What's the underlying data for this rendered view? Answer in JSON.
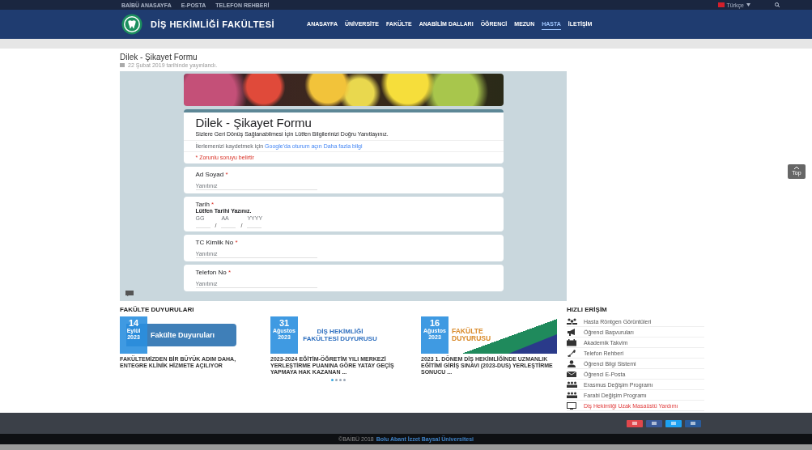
{
  "top_links": [
    "BAİBÜ ANASAYFA",
    "E-POSTA",
    "TELEFON REHBERİ"
  ],
  "language": {
    "label": "Türkçe"
  },
  "site_title": "DİŞ HEKİMLİĞİ FAKÜLTESİ",
  "nav": [
    {
      "label": "ANASAYFA",
      "selected": false
    },
    {
      "label": "ÜNİVERSİTE",
      "selected": false
    },
    {
      "label": "FAKÜLTE",
      "selected": false
    },
    {
      "label": "ANABİLİM DALLARI",
      "selected": false
    },
    {
      "label": "ÖĞRENCİ",
      "selected": false
    },
    {
      "label": "MEZUN",
      "selected": false
    },
    {
      "label": "HASTA",
      "selected": true
    },
    {
      "label": "İLETİŞİM",
      "selected": false
    }
  ],
  "page": {
    "title": "Dilek - Şikayet Formu",
    "meta": "22 Şubat 2019 tarihinde yayınlandı."
  },
  "form": {
    "title": "Dilek - Şikayet Formu",
    "description": "Sizlere Geri Dönüş Sağlanabilmesi İçin Lütfen  Bilgilerinizi Doğru Yanıtlayınız.",
    "signin_text": "İlerlemenizi kaydetmek için",
    "signin_link": "Google'da oturum açın",
    "more_link": "Daha fazla bilgi",
    "required_note": "* Zorunlu soruyu belirtir",
    "questions": [
      {
        "kind": "text",
        "label": "Ad Soyad",
        "required": true,
        "required_mark": "*",
        "placeholder": "Yanıtınız"
      },
      {
        "kind": "date",
        "label": "Tarih",
        "required": true,
        "required_mark": "*",
        "hint": "Lütfen Tarihi Yazınız.",
        "parts": [
          "GG",
          "AA",
          "YYYY"
        ],
        "separators": [
          "/",
          "/"
        ]
      },
      {
        "kind": "text",
        "label": "TC Kimlik No",
        "required": true,
        "required_mark": "*",
        "placeholder": "Yanıtınız"
      },
      {
        "kind": "text",
        "label": "Telefon No",
        "required": true,
        "required_mark": "*",
        "placeholder": "Yanıtınız"
      }
    ]
  },
  "top_button": {
    "label": "Top"
  },
  "announcements": {
    "title": "FAKÜLTE DUYURULARI",
    "items": [
      {
        "day": "14",
        "month": "Eylül",
        "year": "2023",
        "image_text": "Fakülte Duyuruları",
        "kind": "tab",
        "text": "FAKÜLTEMİZDEN BİR BÜYÜK ADIM DAHA, ENTEGRE KLİNİK HİZMETE AÇILIYOR"
      },
      {
        "day": "31",
        "month": "Ağustos",
        "year": "2023",
        "image_text": "DİŞ HEKİMLİĞİ FAKÜLTESİ DUYURUSU",
        "kind": "seal",
        "text": "2023-2024 EĞİTİM-ÖĞRETİM YILI MERKEZİ YERLEŞTİRME PUANINA GÖRE YATAY GEÇİŞ YAPMAYA HAK KAZANAN ..."
      },
      {
        "day": "16",
        "month": "Ağustos",
        "year": "2023",
        "image_text": "FAKÜLTE DUYURUSU",
        "kind": "flag",
        "text": "2023 1. DÖNEM DİŞ HEKİMLİĞİNDE UZMANLIK EĞİTİMİ GİRİŞ SINAVI (2023-DUS) YERLEŞTİRME SONUCU ..."
      }
    ],
    "dots": [
      {
        "selected": true
      },
      {
        "selected": false
      },
      {
        "selected": false
      },
      {
        "selected": false
      }
    ]
  },
  "quick_access": {
    "title": "HIZLI ERİŞİM",
    "items": [
      {
        "label": "Hasta Röntgen Görüntüleri",
        "kind": "people",
        "highlight": false
      },
      {
        "label": "Öğrenci Başvuruları",
        "kind": "megaphone",
        "highlight": false
      },
      {
        "label": "Akademik Takvim",
        "kind": "calendar",
        "highlight": false
      },
      {
        "label": "Telefon Rehberi",
        "kind": "phone",
        "highlight": false
      },
      {
        "label": "Öğrenci Bilgi Sistemi",
        "kind": "person",
        "highlight": false
      },
      {
        "label": "Öğrenci E-Posta",
        "kind": "envelope",
        "highlight": false
      },
      {
        "label": "Erasmus Değişim Programı",
        "kind": "group",
        "highlight": false
      },
      {
        "label": "Farabi Değişim Programı",
        "kind": "group",
        "highlight": false
      },
      {
        "label": "Diş Hekimliği Uzak Masaüstü Yardımı",
        "kind": "monitor",
        "highlight": true
      }
    ]
  },
  "social": [
    {
      "color": "#e0474c"
    },
    {
      "color": "#3b5998"
    },
    {
      "color": "#1da1f2"
    },
    {
      "color": "#2a5b9a"
    }
  ],
  "copyright": {
    "text": "©BAİBÜ 2018",
    "link": "Bolu Abant İzzet Baysal Üniversitesi"
  }
}
